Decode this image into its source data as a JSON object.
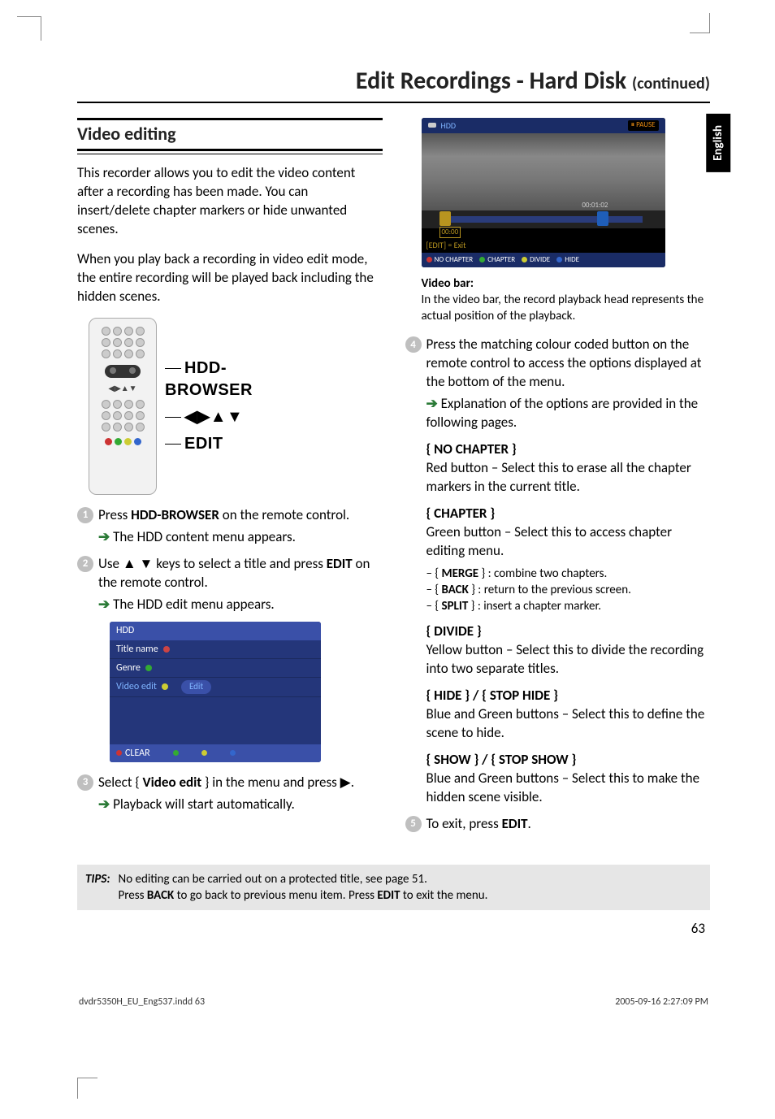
{
  "title_main": "Edit Recordings - Hard Disk",
  "title_cont": "(continued)",
  "side_tab": "English",
  "section_heading": "Video editing",
  "intro_p1": "This recorder allows you to edit the video content after a recording has been made. You can insert/delete chapter markers or hide unwanted scenes.",
  "intro_p2": "When you play back a recording in video edit mode, the entire recording will be played back including the hidden scenes.",
  "remote": {
    "label1": "HDD-BROWSER",
    "label2": "◀▶▲▼",
    "label3": "EDIT"
  },
  "steps": {
    "s1_a": "Press ",
    "s1_b": "HDD-BROWSER",
    "s1_c": " on the remote control.",
    "s1_res": " The HDD content menu appears.",
    "s2_a": "Use ▲ ▼ keys to select a title and press ",
    "s2_b": "EDIT",
    "s2_c": " on the remote control.",
    "s2_res": " The HDD edit menu appears.",
    "s3_a": "Select { ",
    "s3_b": "Video edit",
    "s3_c": " } in the menu and press ▶.",
    "s3_res": " Playback will start automatically.",
    "s4": "Press the matching colour coded button on the remote control to access the options displayed at the bottom of the menu.",
    "s4_res": " Explanation of the options are provided in the following pages.",
    "s5_a": "To exit, press ",
    "s5_b": "EDIT",
    "s5_c": "."
  },
  "menu": {
    "top": "HDD",
    "r1": "Title name",
    "r2": "Genre",
    "r3": "Video edit",
    "btn": "Edit",
    "clear": "CLEAR"
  },
  "video": {
    "hdd": "HDD",
    "pause": "PAUSE",
    "time_l": "00:00",
    "time_r": "00:01:02",
    "exit": "[EDIT] = Exit",
    "b1": "NO CHAPTER",
    "b2": "CHAPTER",
    "b3": "DIVIDE",
    "b4": "HIDE"
  },
  "video_bar_head": "Video bar:",
  "video_bar_text": "In the video bar, the record playback head represents the actual position of the playback.",
  "options": {
    "o1_head": "{ NO CHAPTER }",
    "o1_body": "Red button – Select this to erase all the chapter markers in the current title.",
    "o2_head": "{ CHAPTER }",
    "o2_body": "Green button – Select this to access chapter editing menu.",
    "o2_s1a": "– { ",
    "o2_s1b": "MERGE",
    "o2_s1c": " } : combine two chapters.",
    "o2_s2a": "– { ",
    "o2_s2b": "BACK",
    "o2_s2c": " } : return to the previous screen.",
    "o2_s3a": "– { ",
    "o2_s3b": "SPLIT",
    "o2_s3c": " } : insert a chapter marker.",
    "o3_head": "{ DIVIDE }",
    "o3_body": "Yellow button – Select this to divide the recording into two separate titles.",
    "o4_head": "{ HIDE } / { STOP HIDE }",
    "o4_body": "Blue and Green buttons – Select this to define the scene to hide.",
    "o5_head": "{ SHOW } / { STOP SHOW }",
    "o5_body": "Blue and Green buttons – Select this to make the hidden scene visible."
  },
  "tips_label": "TIPS:",
  "tips_l1": "No editing can be carried out on a protected title, see page 51.",
  "tips_l2a": "Press ",
  "tips_l2b": "BACK",
  "tips_l2c": " to go back to previous menu item. Press ",
  "tips_l2d": "EDIT",
  "tips_l2e": " to exit the menu.",
  "page_number": "63",
  "footer_left": "dvdr5350H_EU_Eng537.indd   63",
  "footer_right": "2005-09-16   2:27:09 PM"
}
